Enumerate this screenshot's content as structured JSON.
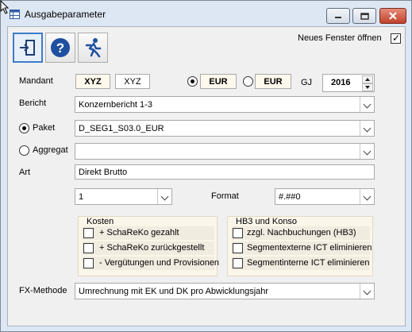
{
  "window": {
    "title": "Ausgabeparameter"
  },
  "toolbar": {
    "items": [
      {
        "name": "exit",
        "icon": "exit-door-icon"
      },
      {
        "name": "help",
        "icon": "question-icon"
      },
      {
        "name": "run",
        "icon": "running-man-icon"
      }
    ],
    "new_window_label": "Neues Fenster öffnen",
    "new_window_checked": true
  },
  "mandant": {
    "label": "Mandant",
    "code_selected": "XYZ",
    "code_other": "XYZ",
    "currency_1": "EUR",
    "currency_2": "EUR",
    "currency_1_selected": true,
    "gj_label": "GJ",
    "gj_value": "2016"
  },
  "bericht": {
    "label": "Bericht",
    "value": "Konzernbericht 1-3"
  },
  "paket": {
    "label": "Paket",
    "selected": true,
    "value": "D_SEG1_S03.0_EUR"
  },
  "aggregat": {
    "label": "Aggregat",
    "selected": false,
    "value": ""
  },
  "art": {
    "label": "Art",
    "value": "Direkt Brutto",
    "level_value": "1",
    "format_label": "Format",
    "format_value": "#.##0"
  },
  "kosten": {
    "title": "Kosten",
    "items": [
      {
        "label": "+ SchaReKo gezahlt",
        "checked": false
      },
      {
        "label": "+ SchaReKo zurückgestellt",
        "checked": false
      },
      {
        "label": "- Vergütungen und Provisionen",
        "checked": false
      }
    ]
  },
  "hb3": {
    "title": "HB3 und Konso",
    "items": [
      {
        "label": "zzgl. Nachbuchungen (HB3)",
        "checked": false
      },
      {
        "label": "Segmentexterne ICT eliminieren",
        "checked": false
      },
      {
        "label": "Segmentinterne ICT eliminieren",
        "checked": false
      }
    ]
  },
  "fx": {
    "label": "FX-Methode",
    "value": "Umrechnung mit EK und DK pro Abwicklungsjahr"
  },
  "colors": {
    "titlebar": "#dde7f3",
    "client": "#f0f0f0",
    "close_button": "#c2412a",
    "help_icon": "#1f4fa0",
    "accent": "#3d7cc9"
  }
}
